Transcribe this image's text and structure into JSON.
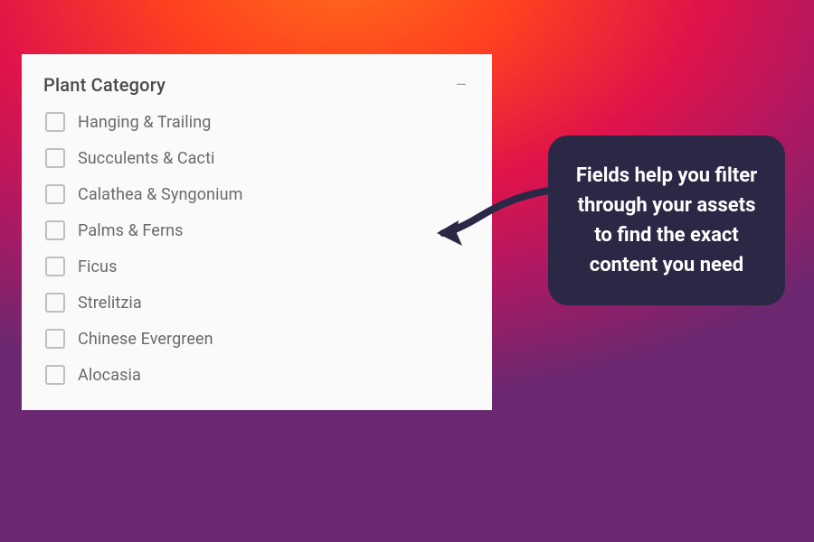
{
  "filter": {
    "title": "Plant Category",
    "options": [
      {
        "label": "Hanging & Trailing"
      },
      {
        "label": "Succulents & Cacti"
      },
      {
        "label": "Calathea & Syngonium"
      },
      {
        "label": "Palms & Ferns"
      },
      {
        "label": "Ficus"
      },
      {
        "label": "Strelitzia"
      },
      {
        "label": "Chinese Evergreen"
      },
      {
        "label": "Alocasia"
      }
    ]
  },
  "callout": {
    "text": "Fields help you filter through your assets to find the exact content you need"
  },
  "colors": {
    "callout_bg": "#2a2845",
    "panel_bg": "#fafafa",
    "text_muted": "#6a6a6a"
  }
}
